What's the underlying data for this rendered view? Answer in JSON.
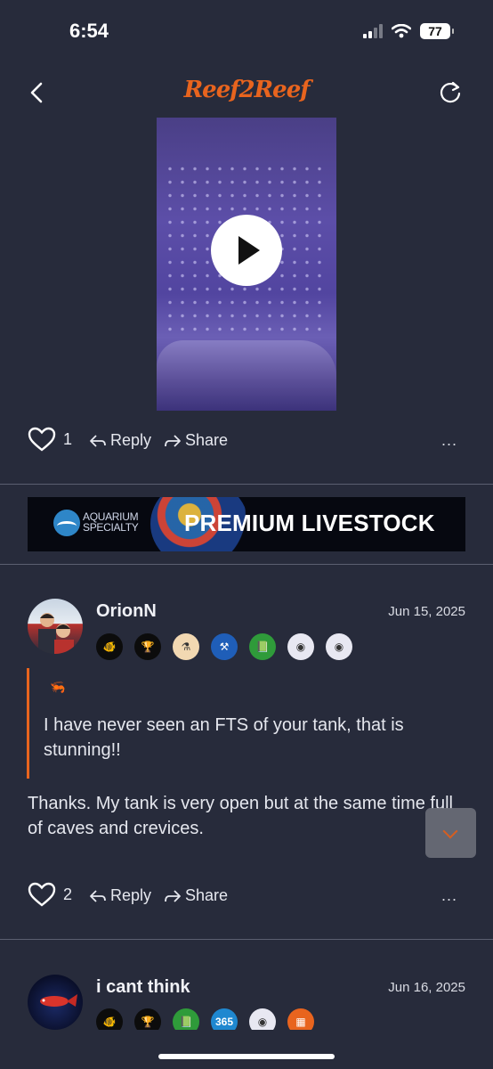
{
  "status_bar": {
    "time": "6:54",
    "battery": "77"
  },
  "header": {
    "logo_text": "Reef2Reef",
    "back_icon": "chevron-left-icon",
    "refresh_icon": "refresh-icon"
  },
  "video_post": {
    "actions": {
      "like_count": "1",
      "reply_label": "Reply",
      "share_label": "Share",
      "more_label": "..."
    }
  },
  "ad_banner": {
    "brand_line1": "AQUARIUM",
    "brand_line2": "SPECIALTY",
    "headline": "PREMIUM LIVESTOCK"
  },
  "post1": {
    "username": "OrionN",
    "date": "Jun 15, 2025",
    "badges": [
      {
        "name": "clownfish-badge",
        "bg": "#0c0c0c",
        "fg": "#f07a2a",
        "glyph": "🐠"
      },
      {
        "name": "trophy-badge",
        "bg": "#0c0c0c",
        "fg": "#f3c21b",
        "glyph": "🏆"
      },
      {
        "name": "reef-badge",
        "bg": "#f2d8b2",
        "fg": "#333",
        "glyph": "⚗"
      },
      {
        "name": "tools-badge",
        "bg": "#1f5eb8",
        "fg": "#fff",
        "glyph": "⚒"
      },
      {
        "name": "journal-badge",
        "bg": "#2f9b3a",
        "fg": "#fff",
        "glyph": "📗"
      },
      {
        "name": "fishbowl-badge",
        "bg": "#e8e8f2",
        "fg": "#333",
        "glyph": "◉"
      },
      {
        "name": "fishbowl-badge-2",
        "bg": "#e8e8f2",
        "fg": "#333",
        "glyph": "◉"
      }
    ],
    "quote_icon": "shrimp-icon",
    "quote_text": "I have never seen an FTS of your tank, that is stunning!!",
    "body_text": "Thanks. My tank is very open but at the same time full of caves and crevices.",
    "actions": {
      "like_count": "2",
      "reply_label": "Reply",
      "share_label": "Share",
      "more_label": "..."
    }
  },
  "post2": {
    "username": "i cant think",
    "date": "Jun 16, 2025",
    "badges": [
      {
        "name": "clownfish-badge",
        "bg": "#0c0c0c",
        "fg": "#f07a2a",
        "glyph": "🐠"
      },
      {
        "name": "trophy-badge",
        "bg": "#0c0c0c",
        "fg": "#f3c21b",
        "glyph": "🏆"
      },
      {
        "name": "journal-badge",
        "bg": "#2f9b3a",
        "fg": "#fff",
        "glyph": "📗"
      },
      {
        "name": "365-badge",
        "bg": "#1f88d0",
        "fg": "#fff",
        "glyph": "365"
      },
      {
        "name": "fishbowl-badge",
        "bg": "#e8e8f2",
        "fg": "#333",
        "glyph": "◉"
      },
      {
        "name": "calendar-badge",
        "bg": "#e8641e",
        "fg": "#fff",
        "glyph": "▦"
      }
    ]
  },
  "colors": {
    "accent": "#e8641e",
    "background": "#272b3b",
    "divider": "#5b5f70"
  }
}
